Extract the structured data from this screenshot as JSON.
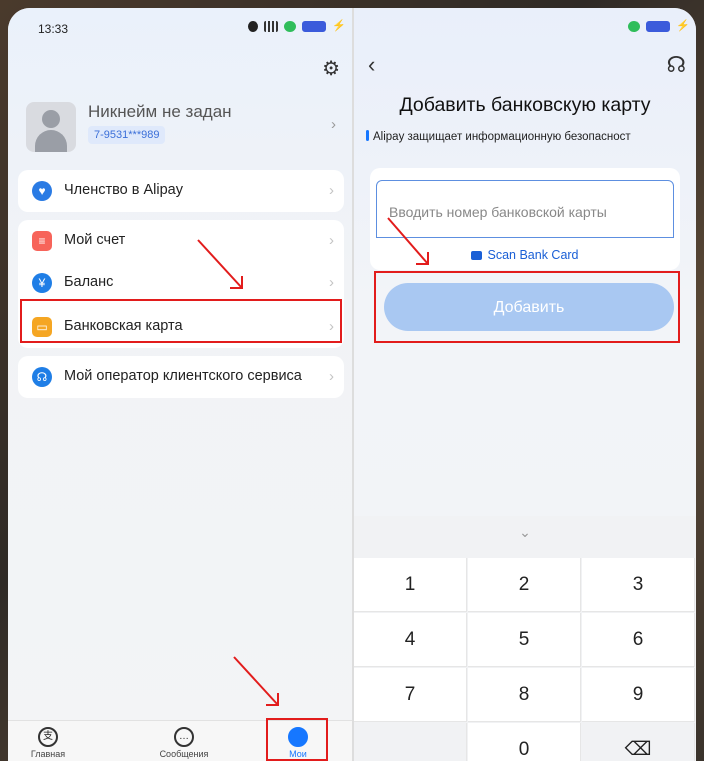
{
  "left_screen": {
    "status_time": "13:33",
    "profile": {
      "nickname": "Никнейм не задан",
      "phone": "7-9531***989"
    },
    "menu": {
      "membership": "Членство в Alipay",
      "account": "Мой счет",
      "balance": "Баланс",
      "bank_card": "Банковская карта",
      "support": "Мой оператор клиентского сервиса"
    },
    "tabs": {
      "home": "Главная",
      "messages": "Сообщения",
      "mine": "Мои"
    }
  },
  "right_screen": {
    "title": "Добавить банковскую карту",
    "security_note": "Alipay защищает информационную безопасност",
    "card_input": {
      "placeholder": "Вводить номер банковской карты",
      "value": ""
    },
    "scan_label": "Scan Bank Card",
    "add_button": "Добавить",
    "keypad": [
      "1",
      "2",
      "3",
      "4",
      "5",
      "6",
      "7",
      "8",
      "9",
      "0"
    ]
  },
  "colors": {
    "accent_blue": "#1677ff",
    "highlight_red": "#e21c1c",
    "button_disabled": "#a9c8f2"
  },
  "icons": [
    "settings-gear-icon",
    "user-avatar-icon",
    "chevron-right-icon",
    "membership-icon",
    "account-icon",
    "balance-icon",
    "bank-card-icon",
    "headset-icon",
    "back-arrow-icon",
    "camera-icon",
    "backspace-icon",
    "chevron-down-icon"
  ]
}
